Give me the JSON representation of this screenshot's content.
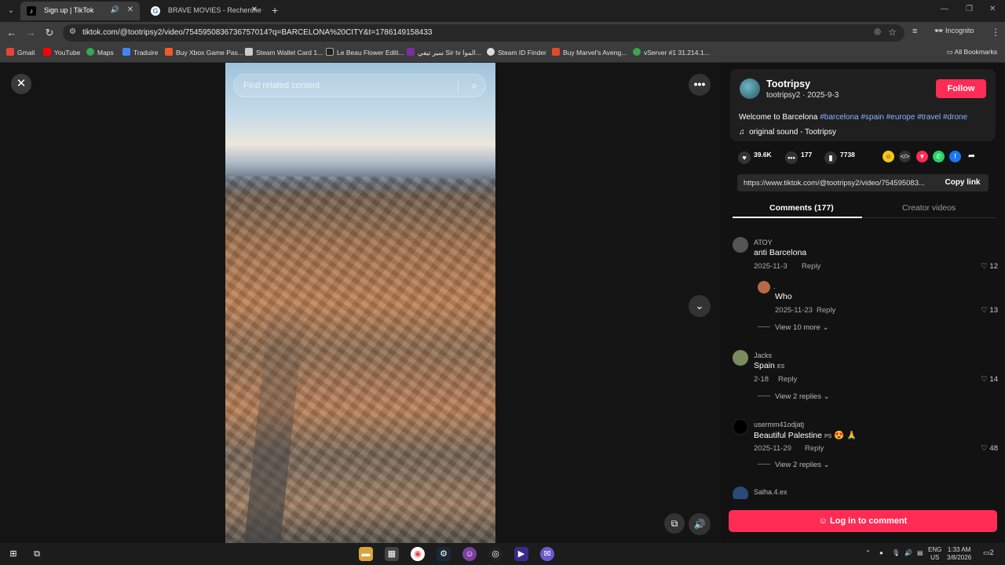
{
  "browser": {
    "tabs": [
      {
        "title": "Sign up | TikTok",
        "active": true
      },
      {
        "title": "BRAVE MOVIES - Recherche Go",
        "active": false
      }
    ],
    "url": "tiktok.com/@tootripsy2/video/7545950836736757014?q=BARCELONA%20CITY&t=1786149158433",
    "profile_label": "Incognito",
    "bookmarks": [
      "Gmail",
      "YouTube",
      "Maps",
      "Traduire",
      "Buy Xbox Game Pas...",
      "Steam Wallet Card 1...",
      "Le Beau Flower Editi...",
      "سير تيفي Sir tv الموا...",
      "Steam ID Finder",
      "Buy Marvel's Aveng...",
      "vServer #1 31.214.1..."
    ],
    "all_bookmarks": "All Bookmarks",
    "icons": {
      "back": "arrow-left-icon",
      "forward": "arrow-right-icon",
      "reload": "reload-icon",
      "incognito_eye": "eye-off-icon",
      "bookmark_star": "star-icon"
    }
  },
  "video": {
    "search_placeholder": "Find related content"
  },
  "post": {
    "author": "Tootripsy",
    "handle_date": "tootripsy2 · 2025-9-3",
    "follow_label": "Follow",
    "description_prefix": "Welcome to Barcelona",
    "hashtags": [
      "#barcelona",
      "#spain",
      "#europe",
      "#travel",
      "#drone"
    ],
    "sound": "original sound - Tootripsy",
    "likes": "39.6K",
    "comments_count": "177",
    "saves": "7738",
    "share_link": "https://www.tiktok.com/@tootripsy2/video/754595083...",
    "copy_link_label": "Copy link",
    "accent": "#fe2c55"
  },
  "tabs": {
    "comments": "Comments (177)",
    "creator_videos": "Creator videos"
  },
  "comments": [
    {
      "user": "ATOY",
      "text": "anti Barcelona",
      "date": "2025-11-3",
      "reply": "Reply",
      "likes": "12"
    },
    {
      "user": ".",
      "text": "Who",
      "date": "2025-11-23",
      "reply": "Reply",
      "likes": "13"
    },
    {
      "user": "Jacks",
      "text": "Spain",
      "flag": "ES",
      "date": "2-18",
      "reply": "Reply",
      "likes": "14"
    },
    {
      "user": "usermm41odjatj",
      "text": "Beautiful Palestine",
      "flag": "PS",
      "emoji": "😍 🙏",
      "date": "2025-11-29",
      "reply": "Reply",
      "likes": "48"
    },
    {
      "user": "Salha.4.ex"
    }
  ],
  "view_more": [
    "View 10 more",
    "View 2 replies",
    "View 2 replies"
  ],
  "login_label": "Log in to comment",
  "taskbar": {
    "lang": "ENG",
    "region": "US",
    "time": "1:33 AM",
    "date": "3/8/2026",
    "notifications": "2"
  }
}
